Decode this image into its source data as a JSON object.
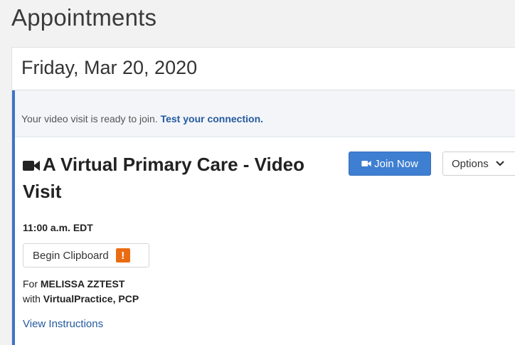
{
  "page": {
    "title": "Appointments"
  },
  "appointment_day": {
    "date": "Friday, Mar 20, 2020"
  },
  "notice": {
    "text": "Your video visit is ready to join. ",
    "link": "Test your connection."
  },
  "appointment": {
    "title": "A Virtual Primary Care - Video Visit",
    "time": "11:00 a.m. EDT",
    "join_label": "Join Now",
    "options_label": "Options",
    "clipboard_label": "Begin Clipboard",
    "clipboard_badge": "!",
    "for_prefix": "For ",
    "patient_name": "MELISSA ZZTEST",
    "with_prefix": "with ",
    "provider": "VirtualPractice, PCP",
    "instructions_link": "View Instructions"
  },
  "icons": {
    "title_icon": "video-camera-icon",
    "join_icon": "video-camera-icon",
    "options_icon": "chevron-down-icon",
    "badge_icon": "exclamation-icon"
  },
  "colors": {
    "accent": "#3f74c6",
    "button_blue": "#3f7fd1",
    "link": "#245a9e",
    "warning": "#ea6c12"
  }
}
